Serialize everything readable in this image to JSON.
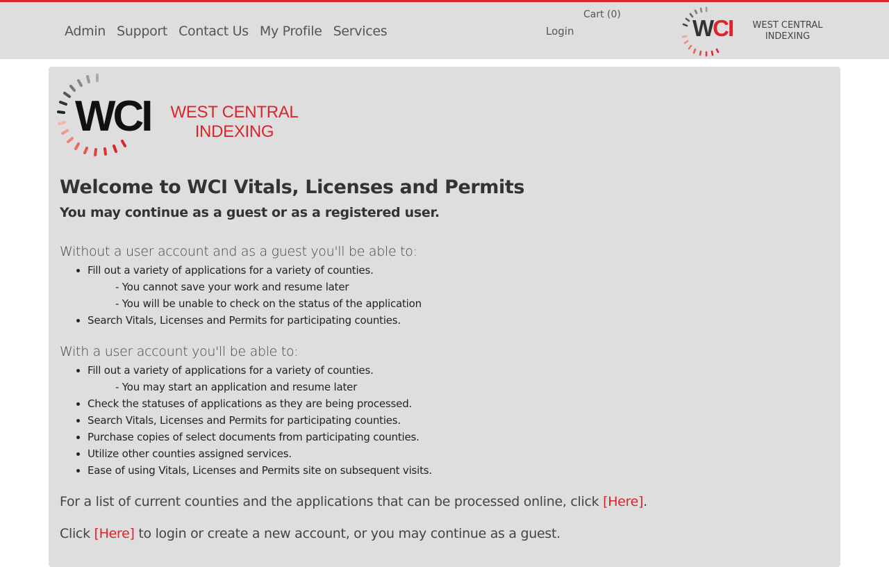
{
  "nav": {
    "items": [
      "Admin",
      "Support",
      "Contact Us",
      "My Profile",
      "Services"
    ],
    "cart": "Cart (0)",
    "login": "Login"
  },
  "logo": {
    "mark_w": "W",
    "mark_ci": "CI",
    "line1": "WEST CENTRAL",
    "line2": "INDEXING"
  },
  "main": {
    "title": "Welcome to WCI Vitals, Licenses and Permits",
    "subtitle": "You may continue as a guest or as a registered user.",
    "guest": {
      "heading": "Without a user account and as a guest you'll be able to:",
      "item1": "Fill out a variety of applications for a variety of counties.",
      "item1_note1": "- You cannot save your work and resume later",
      "item1_note2": "- You will be unable to check on the status of the application",
      "item2": "Search Vitals, Licenses and Permits for participating counties."
    },
    "user": {
      "heading": "With a user account you'll be able to:",
      "item1": "Fill out a variety of applications for a variety of counties.",
      "item1_note1": "- You may start an application and resume later",
      "item2": "Check the statuses of applications as they are being processed.",
      "item3": "Search Vitals, Licenses and Permits for participating counties.",
      "item4": "Purchase copies of select documents from participating counties.",
      "item5": "Utilize other counties assigned services.",
      "item6": "Ease of using Vitals, Licenses and Permits site on subsequent visits."
    },
    "counties_text": "For a list of current counties and the applications that can be processed online, click ",
    "counties_link": "[Here]",
    "counties_end": ".",
    "login_pre": "Click ",
    "login_link": "[Here]",
    "login_post": " to login or create a new account, or you may continue as a guest."
  },
  "colors": {
    "accent": "#d9262e",
    "panel": "#dedede"
  }
}
